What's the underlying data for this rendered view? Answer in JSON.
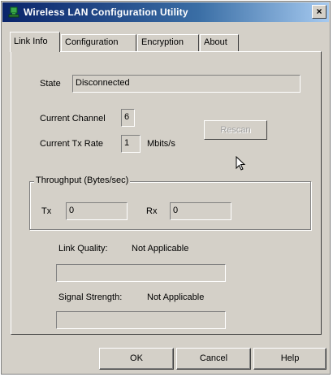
{
  "window": {
    "title": "Wireless LAN Configuration Utility",
    "close_glyph": "×"
  },
  "tabs": [
    {
      "label": "Link Info",
      "active": true
    },
    {
      "label": "Configuration",
      "active": false
    },
    {
      "label": "Encryption",
      "active": false
    },
    {
      "label": "About",
      "active": false
    }
  ],
  "link_info": {
    "state_label": "State",
    "state_value": "Disconnected",
    "channel_label": "Current Channel",
    "channel_value": "6",
    "tx_rate_label": "Current Tx Rate",
    "tx_rate_value": "1",
    "tx_rate_unit": "Mbits/s",
    "rescan_label": "Rescan",
    "throughput_title": "Throughput (Bytes/sec)",
    "tx_label": "Tx",
    "tx_value": "0",
    "rx_label": "Rx",
    "rx_value": "0",
    "link_quality_label": "Link Quality:",
    "link_quality_value": "Not Applicable",
    "signal_strength_label": "Signal Strength:",
    "signal_strength_value": "Not Applicable"
  },
  "buttons": {
    "ok": "OK",
    "cancel": "Cancel",
    "help": "Help"
  },
  "icons": {
    "app": "network-icon",
    "close": "close-icon",
    "cursor": "mouse-pointer-icon"
  }
}
